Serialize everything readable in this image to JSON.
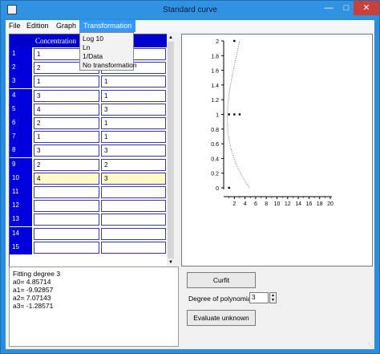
{
  "window": {
    "title": "Standard curve"
  },
  "menu": {
    "file": "File",
    "edition": "Edition",
    "graph": "Graph",
    "transformation": "Transformation"
  },
  "transformation_menu": [
    "Log 10",
    "Ln",
    "1/Data",
    "No transformation"
  ],
  "table": {
    "column1_header": "Concentration",
    "rows": [
      {
        "num": "1",
        "c1": "1",
        "c2": ""
      },
      {
        "num": "2",
        "c1": "2",
        "c2": ""
      },
      {
        "num": "3",
        "c1": "1",
        "c2": "1"
      },
      {
        "num": "4",
        "c1": "3",
        "c2": "1"
      },
      {
        "num": "5",
        "c1": "4",
        "c2": "3"
      },
      {
        "num": "6",
        "c1": "2",
        "c2": "1"
      },
      {
        "num": "7",
        "c1": "1",
        "c2": "1"
      },
      {
        "num": "8",
        "c1": "3",
        "c2": "3"
      },
      {
        "num": "9",
        "c1": "2",
        "c2": "2"
      },
      {
        "num": "10",
        "c1": "4",
        "c2": "3"
      },
      {
        "num": "11",
        "c1": "",
        "c2": ""
      },
      {
        "num": "12",
        "c1": "",
        "c2": ""
      },
      {
        "num": "13",
        "c1": "",
        "c2": ""
      },
      {
        "num": "14",
        "c1": "",
        "c2": ""
      },
      {
        "num": "15",
        "c1": "",
        "c2": ""
      }
    ],
    "highlighted_row": "10"
  },
  "results": {
    "lines": [
      "Fitting degree 3",
      "a0= 4.85714",
      "a1= -9.92857",
      "a2= 7.07143",
      "a3= -1.28571"
    ]
  },
  "controls": {
    "curfit_label": "Curfit",
    "degree_label": "Degree of polynomial",
    "degree_value": "3",
    "evaluate_label": "Evaluate unknown"
  },
  "chart_data": {
    "type": "scatter",
    "xlim": [
      0,
      20
    ],
    "ylim": [
      0,
      2
    ],
    "x_ticks": [
      "2",
      "4",
      "6",
      "8",
      "10",
      "12",
      "14",
      "16",
      "18",
      "20"
    ],
    "y_ticks": [
      "0",
      "0.2",
      "0.4",
      "0.6",
      "0.8",
      "1",
      "1.2",
      "1.4",
      "1.6",
      "1.8",
      "2"
    ],
    "points": [
      [
        1,
        0
      ],
      [
        1,
        1
      ],
      [
        2,
        1
      ],
      [
        3,
        1
      ],
      [
        2,
        2
      ]
    ],
    "fit_coefficients": [
      4.85714,
      -9.92857,
      7.07143,
      -1.28571
    ],
    "colors": {
      "points": "#000000",
      "curve": "#555555"
    }
  }
}
